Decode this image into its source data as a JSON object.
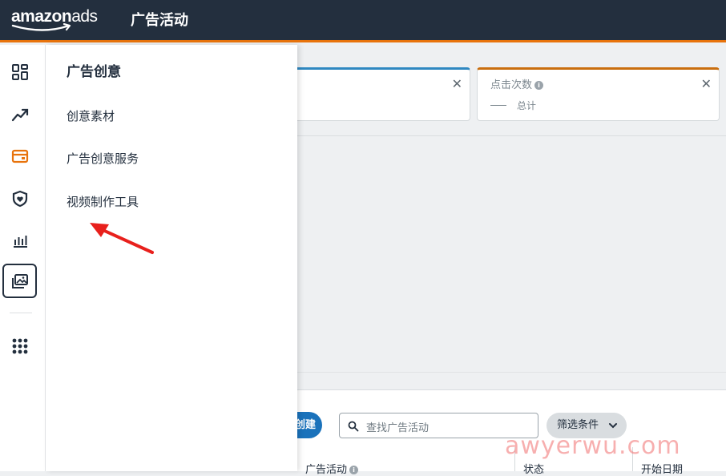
{
  "header": {
    "logo_main": "amazon",
    "logo_suffix": "ads",
    "page_title": "广告活动"
  },
  "rail": {
    "icons": [
      "dashboard-icon",
      "trend-icon",
      "campaign-wallet-icon",
      "brand-shield-icon",
      "reports-bar-icon",
      "creative-gallery-icon",
      "apps-grid-icon"
    ],
    "active": "creative-gallery-icon",
    "accent": "#e8730c"
  },
  "menu": {
    "title": "广告创意",
    "items": [
      "创意素材",
      "广告创意服务",
      "视频制作工具"
    ]
  },
  "metrics": {
    "card2_label": "点击次数",
    "card2_info": "i",
    "card2_total": "总计",
    "close": "✕"
  },
  "toolbar": {
    "create_label": "创建广告活动",
    "search_placeholder": "查找广告活动",
    "filter_label": "筛选条件"
  },
  "table": {
    "headers": [
      "广告活动",
      "状态",
      "开始日期"
    ],
    "header_info": "i"
  },
  "watermark": "awyerwu.com",
  "colors": {
    "topbar": "#232f3e",
    "accent_orange": "#e8730c",
    "primary_blue": "#1a72bb",
    "annotation_arrow": "#e8201c"
  }
}
